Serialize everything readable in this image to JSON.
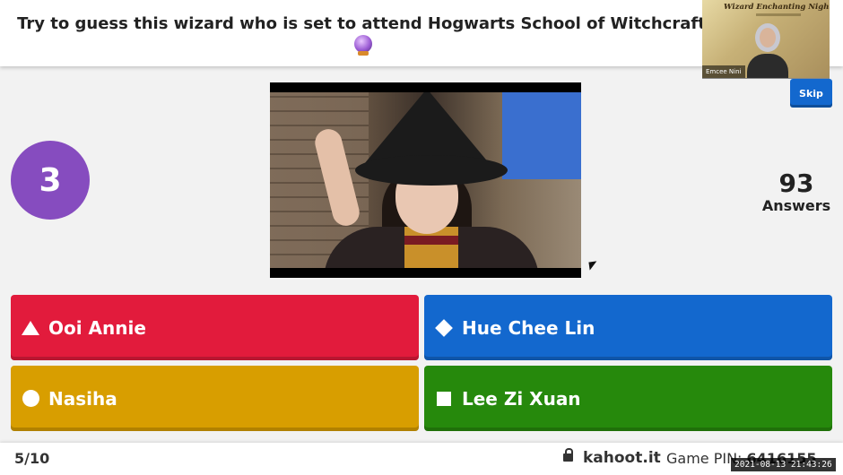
{
  "question": {
    "text": "Try to guess this wizard who is set to attend Hogwarts School of Witchcraft and",
    "emoji": "crystal-ball"
  },
  "webcam": {
    "banner": "Wizard Enchanting Night",
    "name": "Emcee Nini"
  },
  "skip_label": "Skip",
  "timer": {
    "value": "3"
  },
  "answers_counter": {
    "count": "93",
    "label": "Answers"
  },
  "answers": [
    {
      "shape": "triangle",
      "label": "Ooi Annie",
      "color": "#e21b3c"
    },
    {
      "shape": "diamond",
      "label": "Hue Chee Lin",
      "color": "#1368ce"
    },
    {
      "shape": "circle",
      "label": "Nasiha",
      "color": "#d89e00"
    },
    {
      "shape": "square",
      "label": "Lee Zi Xuan",
      "color": "#26890c"
    }
  ],
  "footer": {
    "progress": "5/10",
    "site": "kahoot.it",
    "pin_label": "Game PIN:",
    "pin_value": "6416155"
  },
  "timestamp": "2021-08-13 21:43:26"
}
